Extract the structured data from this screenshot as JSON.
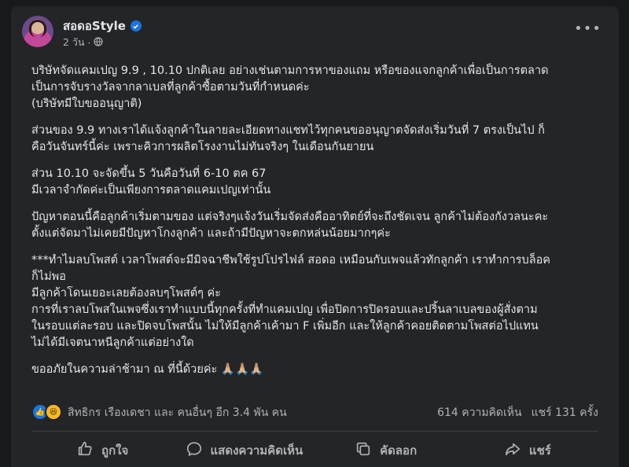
{
  "post": {
    "page_name": "สอดอStyle",
    "time": "2 วัน",
    "visibility_icon": "globe-icon",
    "paragraphs": [
      [
        "บริษัทจัดแคมเปญ 9.9 , 10.10 ปกติเลย อย่างเช่นตามการหาของแถม หรือของแจกลูกค้าเพื่อเป็นการตลาด",
        "เป็นการจับรางวัลจากลาเบลที่ลูกค้าซื้อตามวันที่กำหนดค่ะ",
        "(บริษัทมีใบขออนุญาติ)"
      ],
      [
        "ส่วนของ 9.9 ทางเราได้แจ้งลูกค้าในลายละเอียดทางแชทไว้ทุกคนขออนุญาตจัดส่งเริ่มวันที่ 7 ตรงเป็นไป ก็",
        "คือวันจันทร์นี้ค่ะ เพราะคิวการผลิตโรงงานไม่ทันจริงๆ ในเดือนกันยายน"
      ],
      [
        "ส่วน 10.10 จะจัดขึ้น 5 วันคือวันที่ 6-10 ตค 67",
        "มีเวลาจำกัดค่ะเป็นเพียงการตลาดแคมเปญเท่านั้น"
      ],
      [
        "ปัญหาตอนนี้คือลูกค้าเริ่มตามของ แต่จริงๆแจ้งวันเริ่มจัดส่งคืออาทิตย์ที่จะถึงชัดเจน ลูกค้าไม่ต้องกังวลนะคะ",
        "ตั้งแต่จัดมาไม่เคยมีปัญหาโกงลูกค้า และถ้ามีปัญหาจะตกหล่นน้อยมากๆค่ะ"
      ],
      [
        "***ทำไมลบโพสต์ เวลาโพสต์จะมีมิจฉาชีพใช้รูปโปรไฟล์ สอดอ เหมือนกับเพจแล้วทักลูกค้า เราทำการบล็อค",
        "ก็ไม่พอ",
        "มีลูกค้าโดนเยอะเลยต้องลบๆโพสต์ๆ ค่ะ",
        "การที่เราลบโพสในเพจซึ่งเราทำแบบนี้ทุกครั้งที่ทำแคมเปญ เพื่อปิดการปิดรอบและปริ้นลาเบลของผู้สั่งตาม",
        "ในรอบแต่ละรอบ และปิดจบโพสนั้น ไม่ให้มีลูกค้าเค้ามา F เพิ่มอีก และให้ลูกค้าคอยติดตามโพสต่อไปแทน",
        "ไม่ได้มีเจตนาหนีลูกค้าแต่อย่างใด"
      ],
      [
        "ขออภัยในความล่าช้ามา ณ ที่นี้ด้วยค่ะ 🙏🏼🙏🏼🙏🏼"
      ]
    ]
  },
  "reactions": {
    "summary": "สิทธิกร เรืองเดชา และ คนอื่นๆ อีก 3.4 พัน คน",
    "comments": "614 ความคิดเห็น",
    "shares": "แชร์ 131 ครั้ง"
  },
  "actions": {
    "like": "ถูกใจ",
    "comment": "แสดงความคิดเห็น",
    "copy": "คัดลอก",
    "share": "แชร์"
  },
  "colors": {
    "background": "#18191a",
    "card": "#242526",
    "text": "#e4e6eb",
    "secondary": "#b0b3b8",
    "accent": "#1b74e4"
  }
}
